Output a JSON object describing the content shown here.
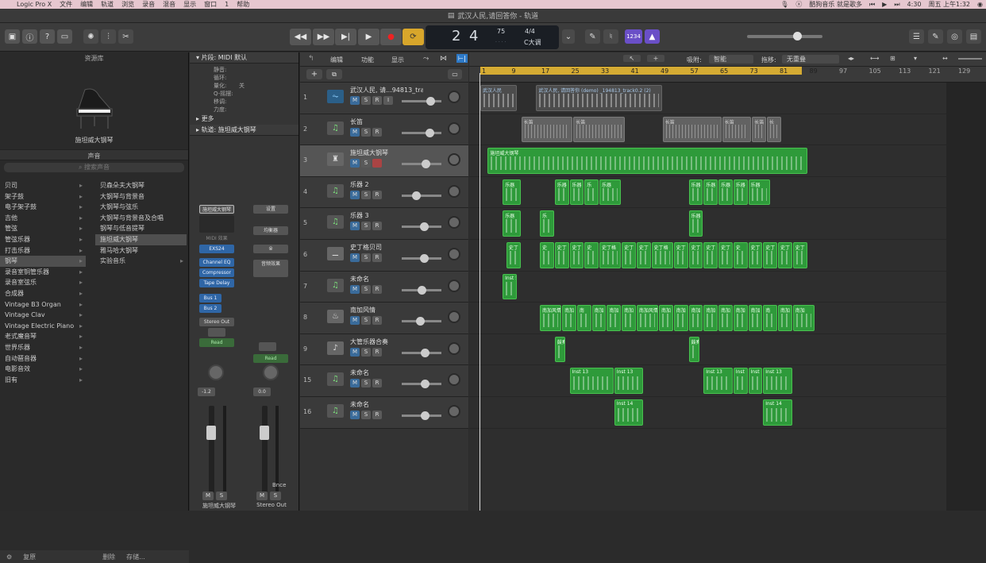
{
  "menubar": {
    "items": [
      "Logic Pro X",
      "文件",
      "编辑",
      "轨道",
      "浏览",
      "录音",
      "混音",
      "显示",
      "窗口",
      "1",
      "帮助"
    ],
    "right": [
      "酷狗音乐 就是歌多",
      "4:30",
      "周五 上午1:32"
    ]
  },
  "window": {
    "title": "武汉人民,请回答你 - 轨道"
  },
  "transport": {
    "bar": "2",
    "beat": "4",
    "tempo": "75",
    "signature": "4/4",
    "key": "C大调",
    "badge": "1234"
  },
  "library": {
    "header": "资源库",
    "current_patch": "施坦威大钢琴",
    "sound_section": "声音",
    "search_placeholder": "搜索声音",
    "categories": [
      "贝司",
      "架子鼓",
      "电子架子鼓",
      "吉他",
      "管弦",
      "管弦乐器",
      "打击乐器",
      "钢琴",
      "录音室铜管乐器",
      "录音室弦乐",
      "合成器",
      "Vintage B3 Organ",
      "Vintage Clav",
      "Vintage Electric Piano",
      "老式魔音琴",
      "世界乐器",
      "自动琶音器",
      "电影音效",
      "旧有"
    ],
    "patches": [
      "贝森朵夫大钢琴",
      "大钢琴与背景音",
      "大钢琴与弦乐",
      "大钢琴与背景音及合唱",
      "钢琴与低音提琴",
      "施坦威大钢琴",
      "雅马哈大钢琴",
      "实验音乐"
    ],
    "footer": [
      "复原",
      "删除",
      "存储..."
    ]
  },
  "inspector": {
    "region_header": "片段: MIDI 默认",
    "params": [
      {
        "label": "静音:",
        "value": ""
      },
      {
        "label": "循环:",
        "value": ""
      },
      {
        "label": "量化:",
        "value": "关"
      },
      {
        "label": "Q-摇摆:",
        "value": ""
      },
      {
        "label": "移调:",
        "value": ""
      },
      {
        "label": "力度:",
        "value": ""
      }
    ],
    "more": "更多",
    "track_header": "轨道: 施坦威大钢琴",
    "strip1": {
      "name": "施坦威大钢琴",
      "plugins": [
        "EXS24",
        "Channel EQ",
        "Compressor",
        "Tape Delay"
      ],
      "sends": [
        "Bus 1",
        "Bus 2"
      ],
      "output": "Stereo Out",
      "automation": "Read",
      "volume": "-1.2",
      "label": "施坦威大钢琴",
      "midi_fx": "MIDI 效果"
    },
    "strip2": {
      "slots": [
        "设置",
        "均衡器",
        "音频效果"
      ],
      "automation": "Read",
      "volume": "0.0",
      "label": "Stereo Out",
      "bounce": "Bnce"
    }
  },
  "arrange_menus": [
    "编辑",
    "功能",
    "显示"
  ],
  "snap": {
    "label": "吸附:",
    "value": "智能"
  },
  "drag": {
    "label": "拖移:",
    "value": "无重叠"
  },
  "ruler": [
    "1",
    "9",
    "17",
    "25",
    "33",
    "41",
    "49",
    "57",
    "65",
    "73",
    "81",
    "89",
    "97",
    "105",
    "113",
    "121",
    "129"
  ],
  "tracks": [
    {
      "num": "1",
      "name": "武汉人民, 请...94813_track0",
      "type": "audio",
      "vol": 0.72,
      "regions": [
        {
          "label": "武汉人民",
          "start": 1,
          "end": 11,
          "kind": "audio2"
        },
        {
          "label": "武汉人民, 请回答你 (demo) _194813_track0.2 (2)",
          "start": 16,
          "end": 50,
          "kind": "audio2"
        }
      ]
    },
    {
      "num": "2",
      "name": "长笛",
      "type": "midi",
      "vol": 0.7,
      "regions": [
        {
          "label": "长笛",
          "start": 12,
          "end": 26,
          "kind": "audio"
        },
        {
          "label": "长笛",
          "start": 26,
          "end": 40,
          "kind": "audio"
        },
        {
          "label": "长笛",
          "start": 50,
          "end": 66,
          "kind": "audio"
        },
        {
          "label": "长笛",
          "start": 66,
          "end": 74,
          "kind": "audio"
        },
        {
          "label": "长笛",
          "start": 74,
          "end": 78,
          "kind": "audio"
        },
        {
          "label": "长",
          "start": 78,
          "end": 82,
          "kind": "audio"
        }
      ]
    },
    {
      "num": "3",
      "name": "施坦威大钢琴",
      "type": "piano",
      "vol": 0.6,
      "regions": [
        {
          "label": "施坦威大钢琴",
          "start": 3,
          "end": 89,
          "kind": "midi"
        }
      ]
    },
    {
      "num": "4",
      "name": "乐器 2",
      "type": "midi",
      "vol": 0.35,
      "regions": [
        {
          "label": "乐器",
          "start": 7,
          "end": 12,
          "kind": "midi"
        },
        {
          "label": "乐器",
          "start": 21,
          "end": 25,
          "kind": "midi"
        },
        {
          "label": "乐器",
          "start": 25,
          "end": 29,
          "kind": "midi"
        },
        {
          "label": "乐",
          "start": 29,
          "end": 33,
          "kind": "midi"
        },
        {
          "label": "乐器",
          "start": 33,
          "end": 39,
          "kind": "midi"
        },
        {
          "label": "乐器",
          "start": 57,
          "end": 61,
          "kind": "midi"
        },
        {
          "label": "乐器",
          "start": 61,
          "end": 65,
          "kind": "midi"
        },
        {
          "label": "乐器",
          "start": 65,
          "end": 69,
          "kind": "midi"
        },
        {
          "label": "乐器",
          "start": 69,
          "end": 73,
          "kind": "midi"
        },
        {
          "label": "乐器",
          "start": 73,
          "end": 79,
          "kind": "midi"
        }
      ]
    },
    {
      "num": "5",
      "name": "乐器 3",
      "type": "midi",
      "vol": 0.55,
      "regions": [
        {
          "label": "乐器",
          "start": 7,
          "end": 12,
          "kind": "midi"
        },
        {
          "label": "乐",
          "start": 17,
          "end": 21,
          "kind": "midi"
        },
        {
          "label": "乐器",
          "start": 57,
          "end": 61,
          "kind": "midi"
        }
      ]
    },
    {
      "num": "6",
      "name": "史丁格贝司",
      "type": "guitar",
      "vol": 0.55,
      "regions": [
        {
          "label": "史丁",
          "start": 8,
          "end": 12,
          "kind": "midi"
        },
        {
          "label": "史",
          "start": 17,
          "end": 21,
          "kind": "midi"
        },
        {
          "label": "史丁",
          "start": 21,
          "end": 25,
          "kind": "midi"
        },
        {
          "label": "史丁",
          "start": 25,
          "end": 29,
          "kind": "midi"
        },
        {
          "label": "史",
          "start": 29,
          "end": 33,
          "kind": "midi"
        },
        {
          "label": "史丁格",
          "start": 33,
          "end": 39,
          "kind": "midi"
        },
        {
          "label": "史丁",
          "start": 39,
          "end": 43,
          "kind": "midi"
        },
        {
          "label": "史丁",
          "start": 43,
          "end": 47,
          "kind": "midi"
        },
        {
          "label": "史丁格",
          "start": 47,
          "end": 53,
          "kind": "midi"
        },
        {
          "label": "史丁",
          "start": 53,
          "end": 57,
          "kind": "midi"
        },
        {
          "label": "史丁",
          "start": 57,
          "end": 61,
          "kind": "midi"
        },
        {
          "label": "史丁",
          "start": 61,
          "end": 65,
          "kind": "midi"
        },
        {
          "label": "史丁",
          "start": 65,
          "end": 69,
          "kind": "midi"
        },
        {
          "label": "史",
          "start": 69,
          "end": 73,
          "kind": "midi"
        },
        {
          "label": "史丁",
          "start": 73,
          "end": 77,
          "kind": "midi"
        },
        {
          "label": "史丁",
          "start": 77,
          "end": 81,
          "kind": "midi"
        },
        {
          "label": "史丁",
          "start": 81,
          "end": 85,
          "kind": "midi"
        },
        {
          "label": "史丁",
          "start": 85,
          "end": 89,
          "kind": "midi"
        }
      ]
    },
    {
      "num": "7",
      "name": "未命名",
      "type": "midi",
      "vol": 0.5,
      "regions": [
        {
          "label": "Inst 5",
          "start": 7,
          "end": 11,
          "kind": "midi"
        }
      ]
    },
    {
      "num": "8",
      "name": "南加风情",
      "type": "drums",
      "vol": 0.45,
      "regions": [
        {
          "label": "南加风情",
          "start": 17,
          "end": 23,
          "kind": "midi"
        },
        {
          "label": "南加",
          "start": 23,
          "end": 27,
          "kind": "midi"
        },
        {
          "label": "南",
          "start": 27,
          "end": 31,
          "kind": "midi"
        },
        {
          "label": "南加",
          "start": 31,
          "end": 35,
          "kind": "midi"
        },
        {
          "label": "南加",
          "start": 35,
          "end": 39,
          "kind": "midi"
        },
        {
          "label": "南加",
          "start": 39,
          "end": 43,
          "kind": "midi"
        },
        {
          "label": "南加风情",
          "start": 43,
          "end": 49,
          "kind": "midi"
        },
        {
          "label": "南加",
          "start": 49,
          "end": 53,
          "kind": "midi"
        },
        {
          "label": "南加",
          "start": 53,
          "end": 57,
          "kind": "midi"
        },
        {
          "label": "南加",
          "start": 57,
          "end": 61,
          "kind": "midi"
        },
        {
          "label": "南加",
          "start": 61,
          "end": 65,
          "kind": "midi"
        },
        {
          "label": "南加",
          "start": 65,
          "end": 69,
          "kind": "midi"
        },
        {
          "label": "南加",
          "start": 69,
          "end": 73,
          "kind": "midi"
        },
        {
          "label": "南加",
          "start": 73,
          "end": 77,
          "kind": "midi"
        },
        {
          "label": "南",
          "start": 77,
          "end": 81,
          "kind": "midi"
        },
        {
          "label": "南加",
          "start": 81,
          "end": 85,
          "kind": "midi"
        },
        {
          "label": "南加",
          "start": 85,
          "end": 91,
          "kind": "midi"
        }
      ]
    },
    {
      "num": "9",
      "name": "大管乐器合奏",
      "type": "orchestra",
      "vol": 0.58,
      "regions": [
        {
          "label": "鼓奏",
          "start": 21,
          "end": 24,
          "kind": "midi"
        },
        {
          "label": "鼓奏",
          "start": 57,
          "end": 60,
          "kind": "midi"
        }
      ]
    },
    {
      "num": "15",
      "name": "未命名",
      "type": "midi",
      "vol": 0.58,
      "regions": [
        {
          "label": "Inst 13",
          "start": 25,
          "end": 37,
          "kind": "midi"
        },
        {
          "label": "Inst 13",
          "start": 37,
          "end": 45,
          "kind": "midi"
        },
        {
          "label": "Inst 13",
          "start": 61,
          "end": 69,
          "kind": "midi"
        },
        {
          "label": "Inst",
          "start": 69,
          "end": 73,
          "kind": "midi"
        },
        {
          "label": "Inst 1",
          "start": 73,
          "end": 77,
          "kind": "midi"
        },
        {
          "label": "Inst 13",
          "start": 77,
          "end": 85,
          "kind": "midi"
        }
      ]
    },
    {
      "num": "16",
      "name": "未命名",
      "type": "midi",
      "vol": 0.58,
      "regions": [
        {
          "label": "Inst 14",
          "start": 37,
          "end": 45,
          "kind": "midi"
        },
        {
          "label": "Inst 14",
          "start": 77,
          "end": 85,
          "kind": "midi"
        }
      ]
    }
  ]
}
